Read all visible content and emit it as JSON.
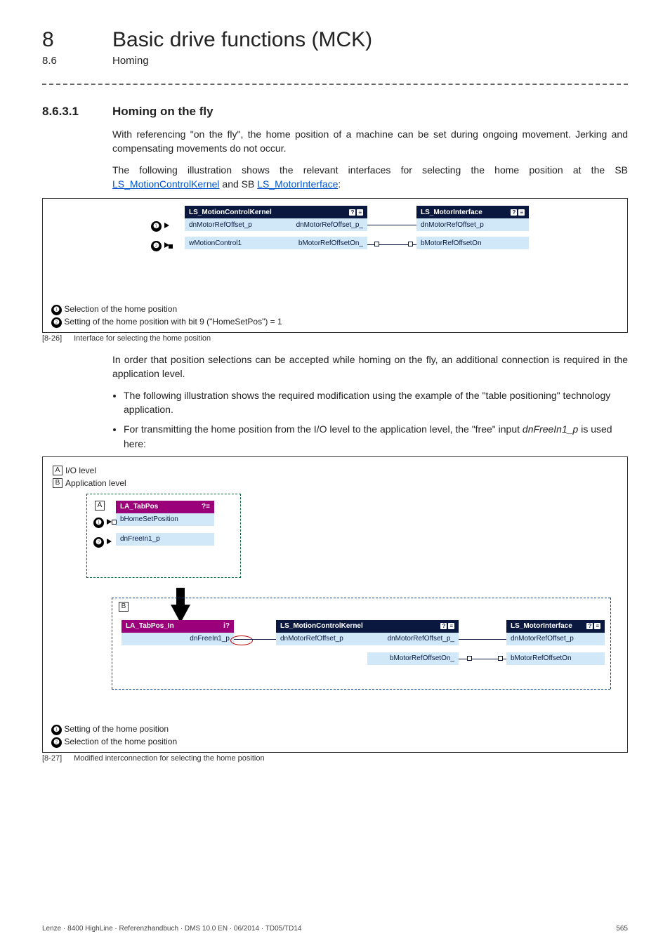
{
  "header": {
    "chapter_num": "8",
    "chapter_title": "Basic drive functions (MCK)",
    "sub_num": "8.6",
    "sub_title": "Homing"
  },
  "section": {
    "num": "8.6.3.1",
    "title": "Homing on the fly"
  },
  "paras": {
    "p1": "With referencing \"on the fly\", the home position of a machine can be set during ongoing movement. Jerking and compensating movements do not occur.",
    "p2a": "The following illustration shows the relevant interfaces for selecting the home position at the SB ",
    "p2_link1": "LS_MotionControlKernel",
    "p2_mid": " and SB ",
    "p2_link2": "LS_MotorInterface",
    "p2_end": ":",
    "p3": "In order that position selections can be accepted while homing on the fly, an additional connection is required in the application level.",
    "li1": "The following illustration shows the required modification using the example of the \"table positioning\" technology application.",
    "li2a": "For transmitting the home position from the I/O level to the application level, the \"free\" input ",
    "li2i": "dnFreeIn1_p",
    "li2b": " is used here:"
  },
  "fig26": {
    "mck": "LS_MotionControlKernel",
    "mi": "LS_MotorInterface",
    "p_refoff_in": "dnMotorRefOffset_p",
    "p_refoff_out": "dnMotorRefOffset_p_",
    "p_wmc": "wMotionControl1",
    "p_bref_out": "bMotorRefOffsetOn_",
    "p_bref_in": "bMotorRefOffsetOn",
    "mi_refoff": "dnMotorRefOffset_p",
    "mi_bref": "bMotorRefOffsetOn",
    "leg1": "Selection of the home position",
    "leg2": "Setting of the home position with bit 9 (\"HomeSetPos\") = 1",
    "cap_tag": "[8-26]",
    "cap_txt": "Interface for selecting the home position"
  },
  "fig27": {
    "lvlA_tag": "A",
    "lvlA_txt": "I/O level",
    "lvlB_tag": "B",
    "lvlB_txt": "Application level",
    "la_tabpos": "LA_TabPos",
    "la_tabpos_in": "LA_TabPos_In",
    "p_home": "bHomeSetPosition",
    "p_free": "dnFreeIn1_p",
    "p_free2": "dnFreeIn1_p",
    "mck": "LS_MotionControlKernel",
    "mi": "LS_MotorInterface",
    "p_refoff_in": "dnMotorRefOffset_p",
    "p_refoff_out": "dnMotorRefOffset_p_",
    "p_bref_out": "bMotorRefOffsetOn_",
    "mi_refoff": "dnMotorRefOffset_p",
    "mi_bref": "bMotorRefOffsetOn",
    "leg1": "Setting of the home position",
    "leg2": "Selection of the home position",
    "cap_tag": "[8-27]",
    "cap_txt": "Modified interconnection for selecting the home position"
  },
  "footer": {
    "left": "Lenze · 8400 HighLine · Referenzhandbuch · DMS 10.0 EN · 06/2014 · TD05/TD14",
    "right": "565"
  }
}
